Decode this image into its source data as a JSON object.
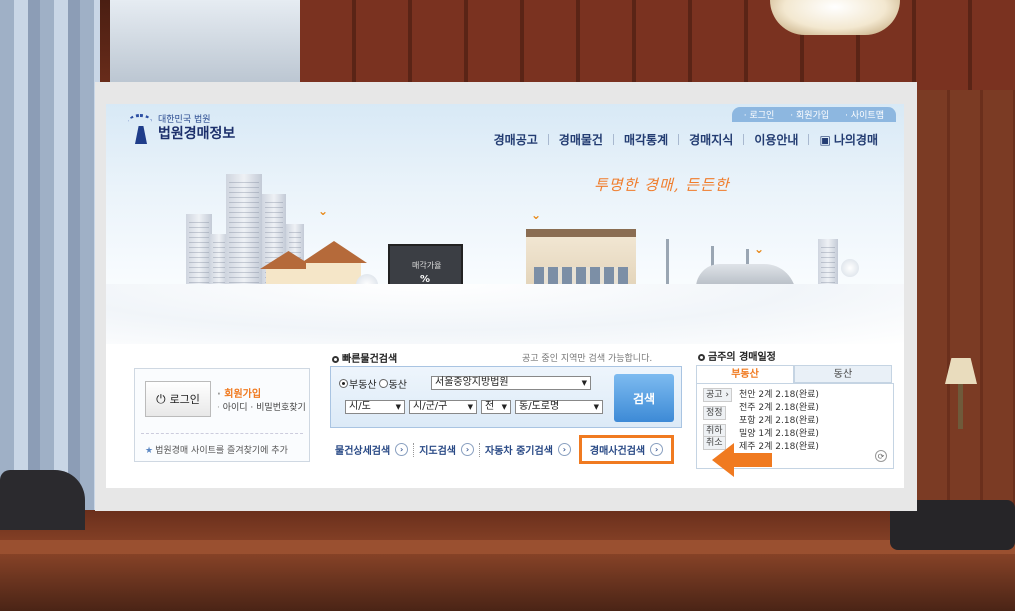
{
  "header": {
    "logo_small": "대한민국 법원",
    "logo_title": "법원경매정보",
    "util_links": [
      "로그인",
      "회원가입",
      "사이트맵"
    ],
    "nav": [
      "경매공고",
      "경매물건",
      "매각통계",
      "경매지식",
      "이용안내",
      "나의경매"
    ],
    "slogan": "투명한 경매, 든든한"
  },
  "billboard": {
    "line1": "매각가율",
    "line2": "%"
  },
  "login": {
    "button": "로그인",
    "join": "회원가입",
    "find": "아이디 · 비밀번호찾기",
    "favorite": "법원경매 사이트를 즐겨찾기에 추가"
  },
  "quick_search": {
    "title": "빠른물건검색",
    "note": "공고 중인 지역만 검색 가능합니다.",
    "radio_real_estate": "부동산",
    "radio_movable": "동산",
    "court": "서울중앙지방법원",
    "sido": "시/도",
    "sigungu": "시/군/구",
    "jeon": "전",
    "dong": "동/도로명",
    "search_button": "검색",
    "tabs": [
      "물건상세검색",
      "지도검색",
      "자동차 중기검색",
      "경매사건검색"
    ]
  },
  "weekly": {
    "title": "금주의 경매일정",
    "tab_active": "부동산",
    "tab_inactive": "동산",
    "side_labels": [
      "공고 ›",
      "정정",
      "취하",
      "취소"
    ],
    "rows": [
      "천안 2계 2.18(완료)",
      "전주 2계 2.18(완료)",
      "포항 2계 2.18(완료)",
      "밀양 1계 2.18(완료)",
      "제주 2계 2.18(완료)"
    ]
  },
  "colors": {
    "accent": "#f07a20",
    "nav": "#233c72",
    "search_button": "#3d8ad6"
  }
}
